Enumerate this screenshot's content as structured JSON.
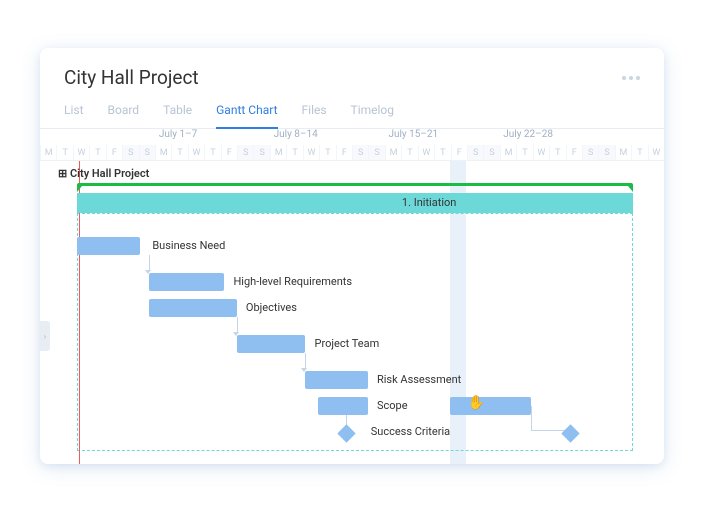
{
  "title": "City Hall Project",
  "tabs": [
    {
      "label": "List",
      "active": false
    },
    {
      "label": "Board",
      "active": false
    },
    {
      "label": "Table",
      "active": false
    },
    {
      "label": "Gantt Chart",
      "active": true
    },
    {
      "label": "Files",
      "active": false
    },
    {
      "label": "Timelog",
      "active": false
    }
  ],
  "weeks": [
    {
      "label": "July 1–7"
    },
    {
      "label": "July 8–14"
    },
    {
      "label": "July 15–21"
    },
    {
      "label": "July 22–28"
    }
  ],
  "day_letters": [
    "M",
    "T",
    "W",
    "T",
    "F",
    "S",
    "S"
  ],
  "project_row": {
    "label": "City Hall Project"
  },
  "phase": {
    "label": "1. Initiation"
  },
  "tasks": [
    {
      "label": "Business Need"
    },
    {
      "label": "High-level Requirements"
    },
    {
      "label": "Objectives"
    },
    {
      "label": "Project Team"
    },
    {
      "label": "Risk Assessment"
    },
    {
      "label": "Scope"
    },
    {
      "label": "Success Criteria"
    }
  ],
  "chart_data": {
    "type": "gantt",
    "unit": "day",
    "start": "2019-06-24",
    "end": "2019-07-31",
    "today": "2019-06-26",
    "highlight_range": [
      "2019-07-18",
      "2019-07-19"
    ],
    "weeks": [
      "July 1–7",
      "July 8–14",
      "July 15–21",
      "July 22–28"
    ],
    "rows": [
      {
        "name": "City Hall Project",
        "type": "project",
        "start": "2019-06-26",
        "end": "2019-07-30"
      },
      {
        "name": "1. Initiation",
        "type": "phase",
        "start": "2019-06-26",
        "end": "2019-07-30",
        "group_end": "2019-07-16"
      },
      {
        "name": "Business Need",
        "type": "task",
        "start": "2019-06-26",
        "end": "2019-06-30"
      },
      {
        "name": "High-level Requirements",
        "type": "task",
        "start": "2019-07-01",
        "end": "2019-07-05"
      },
      {
        "name": "Objectives",
        "type": "task",
        "start": "2019-07-01",
        "end": "2019-07-06"
      },
      {
        "name": "Project Team",
        "type": "task",
        "start": "2019-07-06",
        "end": "2019-07-10"
      },
      {
        "name": "Risk Assessment",
        "type": "task",
        "start": "2019-07-10",
        "end": "2019-07-14"
      },
      {
        "name": "Scope",
        "type": "task",
        "start": "2019-07-11",
        "end": "2019-07-14"
      },
      {
        "name": "Success Criteria",
        "type": "milestone",
        "date": "2019-07-13"
      },
      {
        "name": "(drag task)",
        "type": "task",
        "start": "2019-07-18",
        "end": "2019-07-23"
      },
      {
        "name": "(milestone)",
        "type": "milestone",
        "date": "2019-07-26"
      }
    ]
  }
}
